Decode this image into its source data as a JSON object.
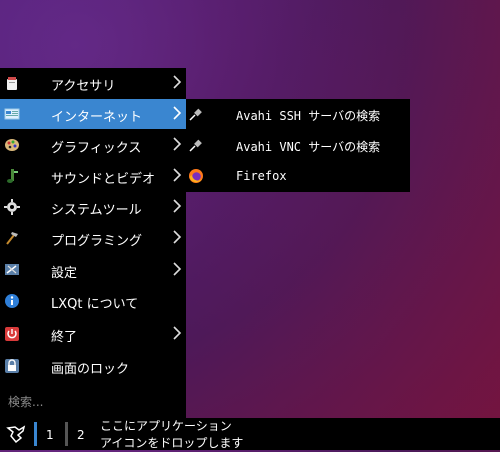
{
  "menu": {
    "items": [
      {
        "label": "アクセサリ",
        "icon": "accessories-icon",
        "submenu": true
      },
      {
        "label": "インターネット",
        "icon": "internet-icon",
        "submenu": true,
        "active": true
      },
      {
        "label": "グラフィックス",
        "icon": "graphics-icon",
        "submenu": true
      },
      {
        "label": "サウンドとビデオ",
        "icon": "sound-video-icon",
        "submenu": true
      },
      {
        "label": "システムツール",
        "icon": "system-tools-icon",
        "submenu": true
      },
      {
        "label": "プログラミング",
        "icon": "programming-icon",
        "submenu": true
      },
      {
        "label": "設定",
        "icon": "settings-icon",
        "submenu": true
      },
      {
        "label": "LXQt について",
        "icon": "about-icon",
        "submenu": false
      },
      {
        "label": "終了",
        "icon": "shutdown-icon",
        "submenu": true
      },
      {
        "label": "画面のロック",
        "icon": "lock-screen-icon",
        "submenu": false
      }
    ],
    "search_placeholder": "検索..."
  },
  "submenu": {
    "items": [
      {
        "label": "Avahi SSH サーバの検索",
        "icon": "plug-icon"
      },
      {
        "label": "Avahi VNC サーバの検索",
        "icon": "plug-icon"
      },
      {
        "label": "Firefox",
        "icon": "firefox-icon"
      }
    ]
  },
  "panel": {
    "desktops": [
      "1",
      "2"
    ],
    "hint_line1": "ここにアプリケーション",
    "hint_line2": "アイコンをドロップします"
  },
  "colors": {
    "accent": "#3a86d0",
    "menu_bg": "#000000",
    "active_desktop_bar": "#3a86d0"
  }
}
